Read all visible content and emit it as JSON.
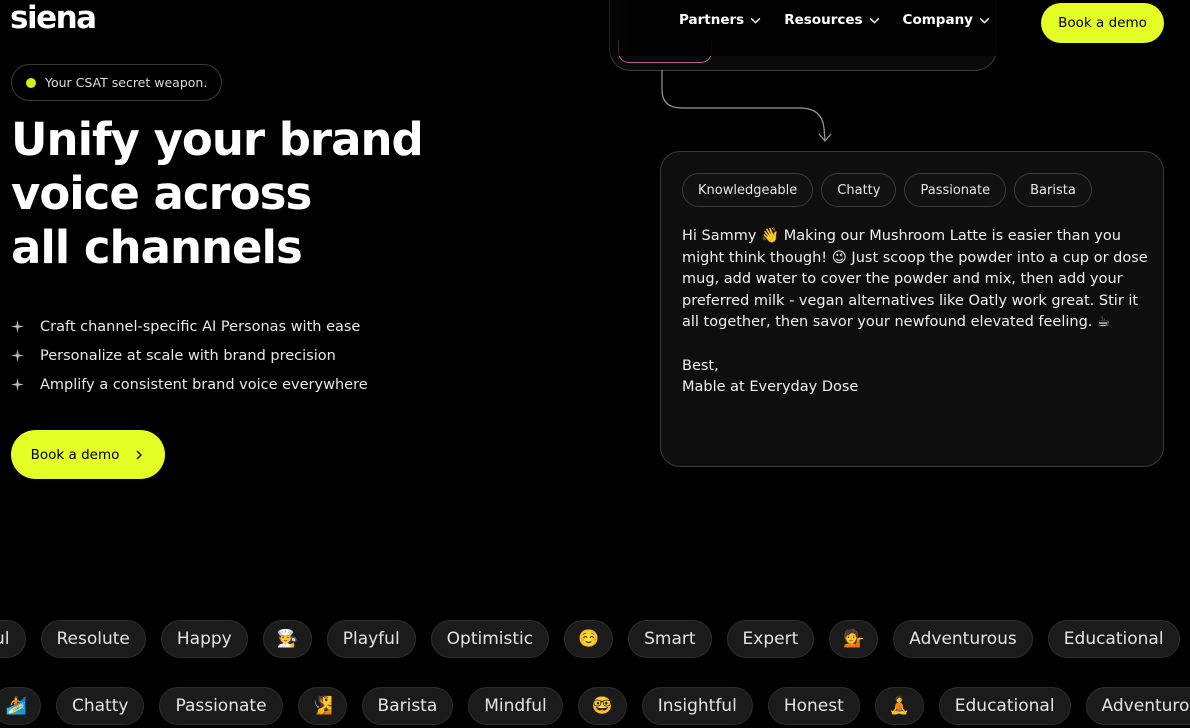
{
  "brand": {
    "logo": "siena",
    "accent": "#e4ff25"
  },
  "nav": {
    "items": [
      {
        "label": "Partners"
      },
      {
        "label": "Resources"
      },
      {
        "label": "Company"
      }
    ],
    "cta_label": "Book a demo"
  },
  "hero": {
    "badge": "Your CSAT secret weapon.",
    "headline": [
      "Unify your brand",
      "voice across",
      "all channels"
    ],
    "features": [
      "Craft channel-specific AI Personas with ease",
      "Personalize at scale with brand precision",
      "Amplify a consistent brand voice everywhere"
    ],
    "cta_label": "Book a demo"
  },
  "card": {
    "tags": [
      "Knowledgeable",
      "Chatty",
      "Passionate",
      "Barista"
    ],
    "message": "Hi Sammy 👋 Making our Mushroom Latte is easier than you might think though! 😉 Just scoop the powder into a cup or dose mug, add water to cover the powder and mix, then add your preferred milk - vegan alternatives like Oatly work great. Stir it all together, then savor your newfound elevated feeling. ☕",
    "signoff": "Best,",
    "signature": "Mable at Everyday Dose"
  },
  "marquee": {
    "row1": [
      "ul",
      "Resolute",
      "Happy",
      "🧑‍🍳",
      "Playful",
      "Optimistic",
      "☺️",
      "Smart",
      "Expert",
      "💁",
      "Adventurous",
      "Educational",
      "🧘"
    ],
    "row2": [
      "🏄",
      "Chatty",
      "Passionate",
      "🧏",
      "Barista",
      "Mindful",
      "🤓",
      "Insightful",
      "Honest",
      "🧘",
      "Educational",
      "Adventurous"
    ]
  }
}
